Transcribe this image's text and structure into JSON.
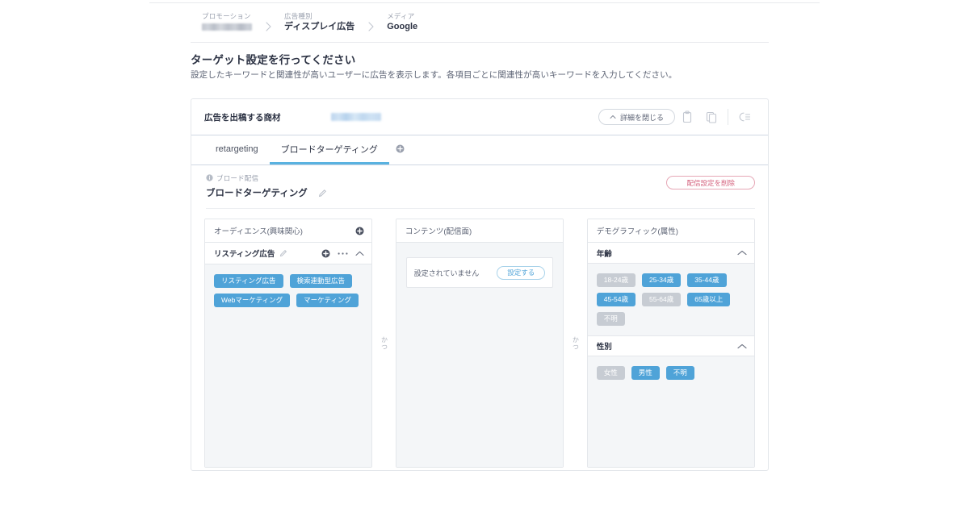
{
  "breadcrumb": [
    {
      "label": "プロモーション",
      "value": "",
      "redacted": true
    },
    {
      "label": "広告種別",
      "value": "ディスプレイ広告",
      "redacted": false
    },
    {
      "label": "メディア",
      "value": "Google",
      "redacted": false
    }
  ],
  "heading": {
    "title": "ターゲット設定を行ってください",
    "description": "設定したキーワードと関連性が高いユーザーに広告を表示します。各項目ごとに関連性が高いキーワードを入力してください。"
  },
  "card": {
    "header": {
      "title": "広告を出稿する商材",
      "value": "",
      "collapse_label": "詳細を閉じる",
      "icons": {
        "paste": "clipboard-icon",
        "copy": "copy-icon",
        "list": "list-settings-icon"
      }
    },
    "tabs": [
      {
        "label": "retargeting",
        "active": false
      },
      {
        "label": "ブロードターゲティング",
        "active": true
      }
    ],
    "tab_add_icon": "plus-circle-icon",
    "delivery": {
      "kicker": "ブロード配信",
      "kicker_icon": "info-icon",
      "name": "ブロードターゲティング",
      "edit_icon": "pencil-icon",
      "delete_label": "配信設定を削除"
    },
    "conjunctions": [
      "かつ",
      "かつ"
    ],
    "panels": [
      {
        "key": "audience",
        "title": "オーディエンス(興味関心)",
        "add_icon": "plus-circle-icon",
        "group": {
          "title": "リスティング広告",
          "edit_icon": "pencil-icon",
          "add_icon": "plus-circle-icon",
          "more_icon": "ellipsis-icon",
          "collapse_icon": "chevron-up-icon",
          "chips": [
            {
              "label": "リスティング広告",
              "selected": true
            },
            {
              "label": "検索連動型広告",
              "selected": true
            },
            {
              "label": "Webマーケティング",
              "selected": true
            },
            {
              "label": "マーケティング",
              "selected": true
            }
          ]
        }
      },
      {
        "key": "content",
        "title": "コンテンツ(配信面)",
        "empty_text": "設定されていません",
        "empty_button": "設定する"
      },
      {
        "key": "demographic",
        "title": "デモグラフィック(属性)",
        "sections": [
          {
            "title": "年齢",
            "collapse_icon": "chevron-up-icon",
            "chips": [
              {
                "label": "18-24歳",
                "selected": false
              },
              {
                "label": "25-34歳",
                "selected": true
              },
              {
                "label": "35-44歳",
                "selected": true
              },
              {
                "label": "45-54歳",
                "selected": true
              },
              {
                "label": "55-64歳",
                "selected": false
              },
              {
                "label": "65歳以上",
                "selected": true
              },
              {
                "label": "不明",
                "selected": false
              }
            ]
          },
          {
            "title": "性別",
            "collapse_icon": "chevron-up-icon",
            "chips": [
              {
                "label": "女性",
                "selected": false
              },
              {
                "label": "男性",
                "selected": true
              },
              {
                "label": "不明",
                "selected": true
              }
            ]
          }
        ]
      }
    ]
  },
  "colors": {
    "accent_blue": "#4fa3d8",
    "tab_underline": "#59b2e0",
    "chip_off": "#c7ccd3",
    "danger": "#d4617d",
    "border": "#e4e7eb",
    "panel_bg": "#f4f6f8"
  }
}
